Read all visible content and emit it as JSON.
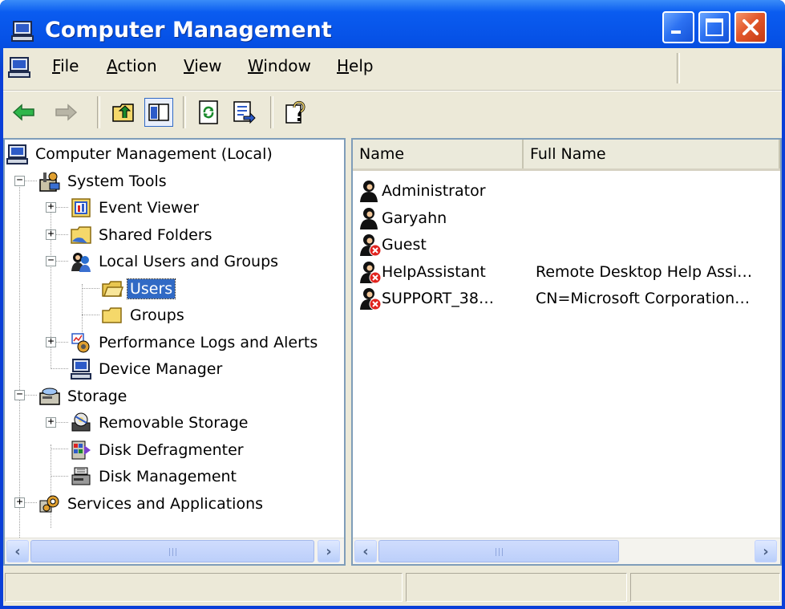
{
  "window": {
    "title": "Computer Management",
    "controls": {
      "minimize": "minimize-icon",
      "maximize": "maximize-icon",
      "close": "close-icon"
    }
  },
  "menu": {
    "items": [
      "File",
      "Action",
      "View",
      "Window",
      "Help"
    ]
  },
  "toolbar": {
    "buttons": [
      "back-arrow-icon",
      "forward-arrow-icon",
      "up-one-level-icon",
      "show-hide-console-tree-icon",
      "refresh-icon",
      "export-list-icon",
      "help-icon"
    ]
  },
  "tree": {
    "nodes": [
      {
        "label": "Computer Management (Local)",
        "icon": "computer-icon"
      },
      {
        "label": "System Tools",
        "icon": "system-tools-icon",
        "expanded": true
      },
      {
        "label": "Event Viewer",
        "icon": "event-viewer-icon",
        "expanded": false
      },
      {
        "label": "Shared Folders",
        "icon": "shared-folders-icon",
        "expanded": false
      },
      {
        "label": "Local Users and Groups",
        "icon": "users-groups-icon",
        "expanded": true
      },
      {
        "label": "Users",
        "icon": "folder-icon",
        "selected": true
      },
      {
        "label": "Groups",
        "icon": "folder-icon"
      },
      {
        "label": "Performance Logs and Alerts",
        "icon": "performance-icon",
        "expanded": false
      },
      {
        "label": "Device Manager",
        "icon": "device-manager-icon"
      },
      {
        "label": "Storage",
        "icon": "storage-icon",
        "expanded": true
      },
      {
        "label": "Removable Storage",
        "icon": "removable-storage-icon",
        "expanded": false
      },
      {
        "label": "Disk Defragmenter",
        "icon": "disk-defragmenter-icon"
      },
      {
        "label": "Disk Management",
        "icon": "disk-management-icon"
      },
      {
        "label": "Services and Applications",
        "icon": "services-icon",
        "expanded": false
      }
    ]
  },
  "list": {
    "columns": [
      "Name",
      "Full Name"
    ],
    "rows": [
      {
        "name": "Administrator",
        "full_name": "",
        "disabled": false
      },
      {
        "name": "Garyahn",
        "full_name": "",
        "disabled": false
      },
      {
        "name": "Guest",
        "full_name": "",
        "disabled": true
      },
      {
        "name": "HelpAssistant",
        "full_name": "Remote Desktop Help Assi…",
        "disabled": true
      },
      {
        "name": "SUPPORT_38…",
        "full_name": "CN=Microsoft Corporation…",
        "disabled": true
      }
    ]
  },
  "colors": {
    "title_bar": "#0651e6",
    "selection": "#316ac5",
    "face": "#ece9d8",
    "pane_border": "#7f9db9"
  }
}
